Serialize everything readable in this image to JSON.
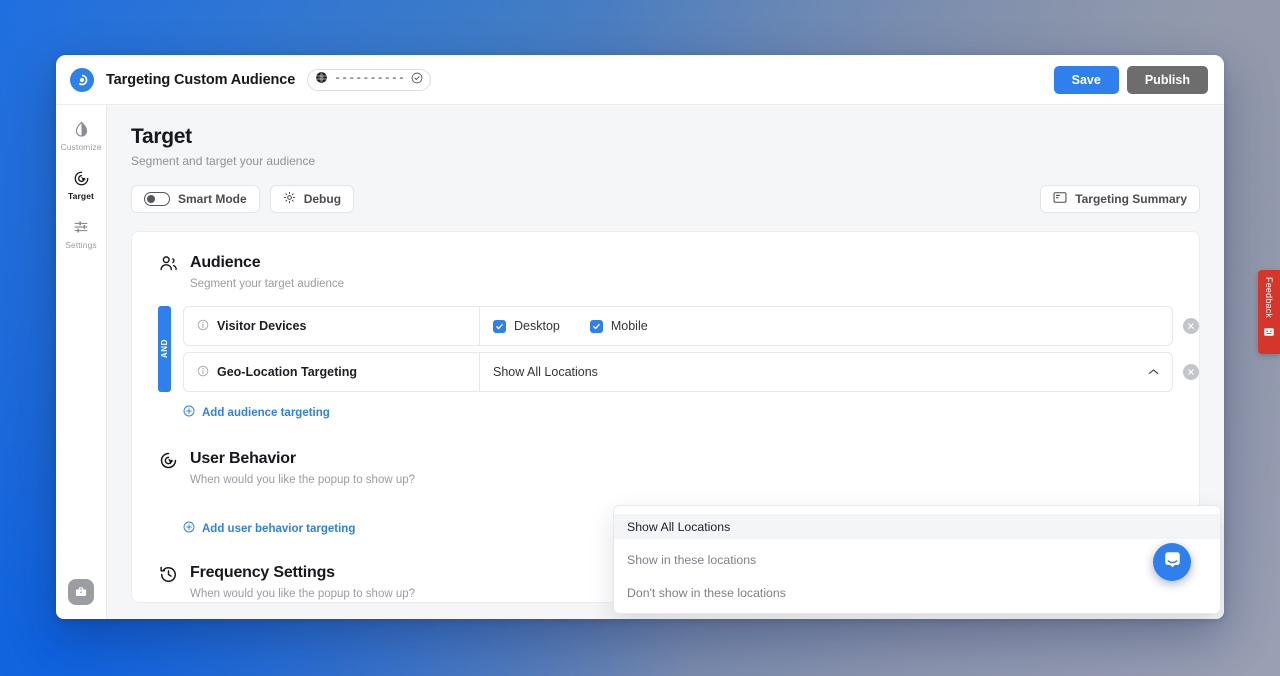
{
  "topbar": {
    "app_title": "Targeting Custom Audience",
    "site_pill": {
      "domain_masked": "----------",
      "globe_icon": "globe-icon",
      "verified_icon": "check-circle-icon"
    },
    "save_label": "Save",
    "publish_label": "Publish",
    "save_color": "#2f80ed",
    "publish_color": "#6d6d6d"
  },
  "sidebar": {
    "items": [
      {
        "label": "Customize",
        "icon": "contrast-droplet-icon",
        "active": false
      },
      {
        "label": "Target",
        "icon": "target-cursor-icon",
        "active": true
      },
      {
        "label": "Settings",
        "icon": "sliders-icon",
        "active": false
      }
    ],
    "bottom_button": {
      "icon": "briefcase-icon",
      "label": ""
    }
  },
  "page": {
    "title": "Target",
    "subtitle": "Segment and target your audience",
    "smart_mode_label": "Smart Mode",
    "smart_mode_on": false,
    "debug_label": "Debug",
    "debug_icon": "gear-icon",
    "targeting_summary_label": "Targeting Summary",
    "targeting_summary_icon": "panel-icon"
  },
  "audience": {
    "title": "Audience",
    "subtitle": "Segment your target audience",
    "icon": "people-icon",
    "operator": "AND",
    "rules": [
      {
        "label": "Visitor Devices",
        "info_icon": "info-icon",
        "type": "checkboxes",
        "options": [
          {
            "label": "Desktop",
            "checked": true
          },
          {
            "label": "Mobile",
            "checked": true
          }
        ],
        "remove_icon": "close-circle-icon"
      },
      {
        "label": "Geo-Location Targeting",
        "info_icon": "info-icon",
        "type": "select",
        "value": "Show All Locations",
        "chevron": "chevron-up-icon",
        "remove_icon": "close-circle-icon"
      }
    ],
    "add_link": "Add audience targeting",
    "add_icon": "plus-circle-icon"
  },
  "geo_dropdown": {
    "open": true,
    "options": [
      {
        "label": "Show All Locations",
        "selected": true
      },
      {
        "label": "Show in these locations",
        "selected": false
      },
      {
        "label": "Don't show in these locations",
        "selected": false
      }
    ]
  },
  "user_behavior": {
    "title": "User Behavior",
    "subtitle": "When would you like the popup to show up?",
    "icon": "target-cursor-icon",
    "add_link": "Add user behavior targeting",
    "add_icon": "plus-circle-icon"
  },
  "frequency": {
    "title": "Frequency Settings",
    "subtitle": "When would you like the popup to show up?",
    "icon": "history-clock-icon"
  },
  "feedback_tab": {
    "label": "Feedback",
    "icon": "feedback-face-icon",
    "color": "#d6352b"
  },
  "chat_launcher": {
    "icon": "chat-bubble-icon",
    "color": "#2f80ed"
  }
}
